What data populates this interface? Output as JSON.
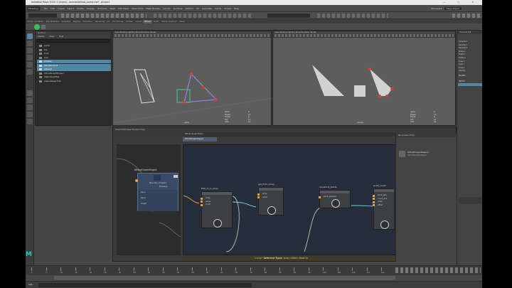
{
  "window": {
    "title": "Autodesk Maya 2019: C:\\Users\\...\\scenes\\bifrost_scene.ma* - pCube1",
    "controls": "— ▢ ✕"
  },
  "menubar": {
    "mode": "Modeling",
    "items": [
      "File",
      "Edit",
      "Create",
      "Select",
      "Modify",
      "Display",
      "Windows",
      "Mesh",
      "Edit Mesh",
      "Mesh Tools",
      "Mesh Display",
      "Curves",
      "Surfaces",
      "Deform",
      "UV",
      "Generate",
      "Cache",
      "Arnold",
      "Help"
    ],
    "workspace_label": "Workspace:",
    "workspace_value": "Maya Classic"
  },
  "shelf_tabs": [
    "Curves / Surfaces",
    "Poly Modeling",
    "Sculpting",
    "Rigging",
    "Animation",
    "Rendering",
    "FX",
    "FX Caching",
    "Custom",
    "Arnold",
    "Bifrost",
    "MASH",
    "Motion Graphics",
    "XGen"
  ],
  "outliner": {
    "title": "Outliner",
    "menu": [
      "Display",
      "Show",
      "Help"
    ],
    "items": [
      {
        "label": "persp",
        "selected": false
      },
      {
        "label": "top",
        "selected": false
      },
      {
        "label": "front",
        "selected": false
      },
      {
        "label": "side",
        "selected": false
      },
      {
        "label": "pCube1",
        "selected": true
      },
      {
        "label": "bifrostGraph1",
        "selected": true
      },
      {
        "label": "pPlane1",
        "selected": true
      },
      {
        "label": "bifrostGraphShape1",
        "selected": false
      },
      {
        "label": "defaultLightSet",
        "selected": false
      },
      {
        "label": "defaultObjectSet",
        "selected": false
      }
    ]
  },
  "viewport_left": {
    "menu": [
      "View",
      "Shading",
      "Lighting",
      "Show",
      "Renderer",
      "Panels"
    ],
    "camera": "persp",
    "hud": "Verts:\nEdges:\nFaces:\nTris:\nUVs:",
    "hud_values": "8\n12\n6\n12\n14",
    "hud2": "Backfaces:\nSmoothness:\nInstance:\nDisplay Layer:\nDistance From Camera:"
  },
  "viewport_right": {
    "menu": [
      "View",
      "Shading",
      "Lighting",
      "Show",
      "Renderer",
      "Panels"
    ],
    "camera": "persp1",
    "hud": "Verts:\nEdges:\nFaces:\nTris:\nUVs:",
    "hud_values": "8\n12\n6\n12\n14"
  },
  "channelbox": {
    "tabs": [
      "Channels",
      "Edit",
      "Object",
      "Show"
    ],
    "attrs": [
      "Translate X",
      "Translate Y",
      "Translate Z",
      "Rotate X",
      "Rotate Y",
      "Rotate Z",
      "Scale X",
      "Scale Y",
      "Scale Z",
      "Visibility"
    ],
    "section": "SHAPES",
    "section2": "INPUTS"
  },
  "bifrost": {
    "title": "Bifrost Graph Editor",
    "menu": [
      "Graph",
      "Edit",
      "View",
      "Window",
      "Help"
    ],
    "tab": "bifrostGraphShape1",
    "left_node": {
      "title": "bifrostGraphShape1",
      "subtitle": "New Obj: Vintage1",
      "message": "Message",
      "ports": [
        "Base",
        "Bend",
        "Target"
      ]
    },
    "nodes": [
      {
        "title": "first_of_in_array",
        "ports": [
          "array",
          "value",
          "count"
        ]
      },
      {
        "title": "get_from_array",
        "ports": [
          "array",
          "index"
        ]
      },
      {
        "title": "construct_points",
        "ports": [
          "point_position"
        ]
      },
      {
        "title": "point_count",
        "ports": [
          "point_geo",
          "count_pos",
          "index",
          "offset"
        ]
      }
    ],
    "status_prefix": "\"value\"",
    "status_inferred": "Inferred Type:",
    "status_type": "array<Math::float3>",
    "properties": {
      "title": "Parameter Editor",
      "node": "bifrostGraphShape1",
      "path": "/bifrostGraphShape1"
    }
  },
  "timeline": {
    "ticks": [
      "1",
      "5",
      "10",
      "15",
      "20",
      "25",
      "30",
      "35",
      "40",
      "45",
      "50",
      "55",
      "60",
      "65",
      "70",
      "75",
      "80",
      "85",
      "90",
      "95",
      "100",
      "105",
      "110",
      "115",
      "120"
    ],
    "current": "1"
  },
  "cmdline": {
    "label": "MEL",
    "value": ""
  }
}
